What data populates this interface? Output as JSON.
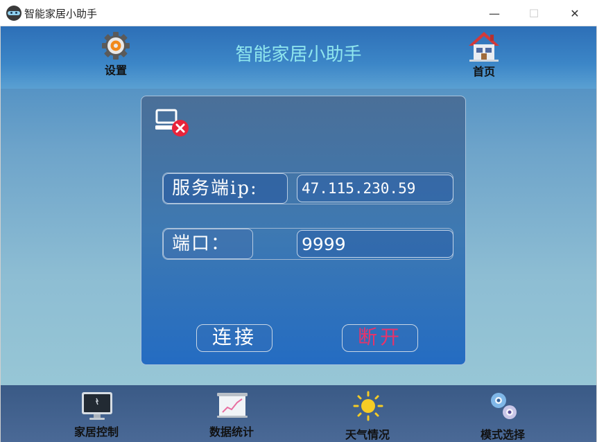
{
  "window": {
    "title": "智能家居小助手",
    "controls": {
      "minimize": "—",
      "maximize": "☐",
      "close": "✕"
    }
  },
  "header": {
    "title": "智能家居小助手",
    "settings_label": "设置",
    "home_label": "首页",
    "settings_icon": "gear-icon",
    "home_icon": "house-icon"
  },
  "connection": {
    "status_icon": "disconnected-computer-icon",
    "server_ip_label": "服务端ip:",
    "server_ip_value": "47.115.230.59",
    "port_label": "端口：",
    "port_value": "9999",
    "connect_label": "连接",
    "disconnect_label": "断开"
  },
  "bottom_nav": {
    "items": [
      {
        "label": "家居控制",
        "icon": "monitor-icon"
      },
      {
        "label": "数据统计",
        "icon": "chart-board-icon"
      },
      {
        "label": "天气情况",
        "icon": "sun-icon"
      },
      {
        "label": "模式选择",
        "icon": "gears-icon"
      }
    ]
  },
  "colors": {
    "header_title": "#8fe6ee",
    "disconnect_text": "#e8336a",
    "card_gradient_bottom": "#246cc2"
  }
}
